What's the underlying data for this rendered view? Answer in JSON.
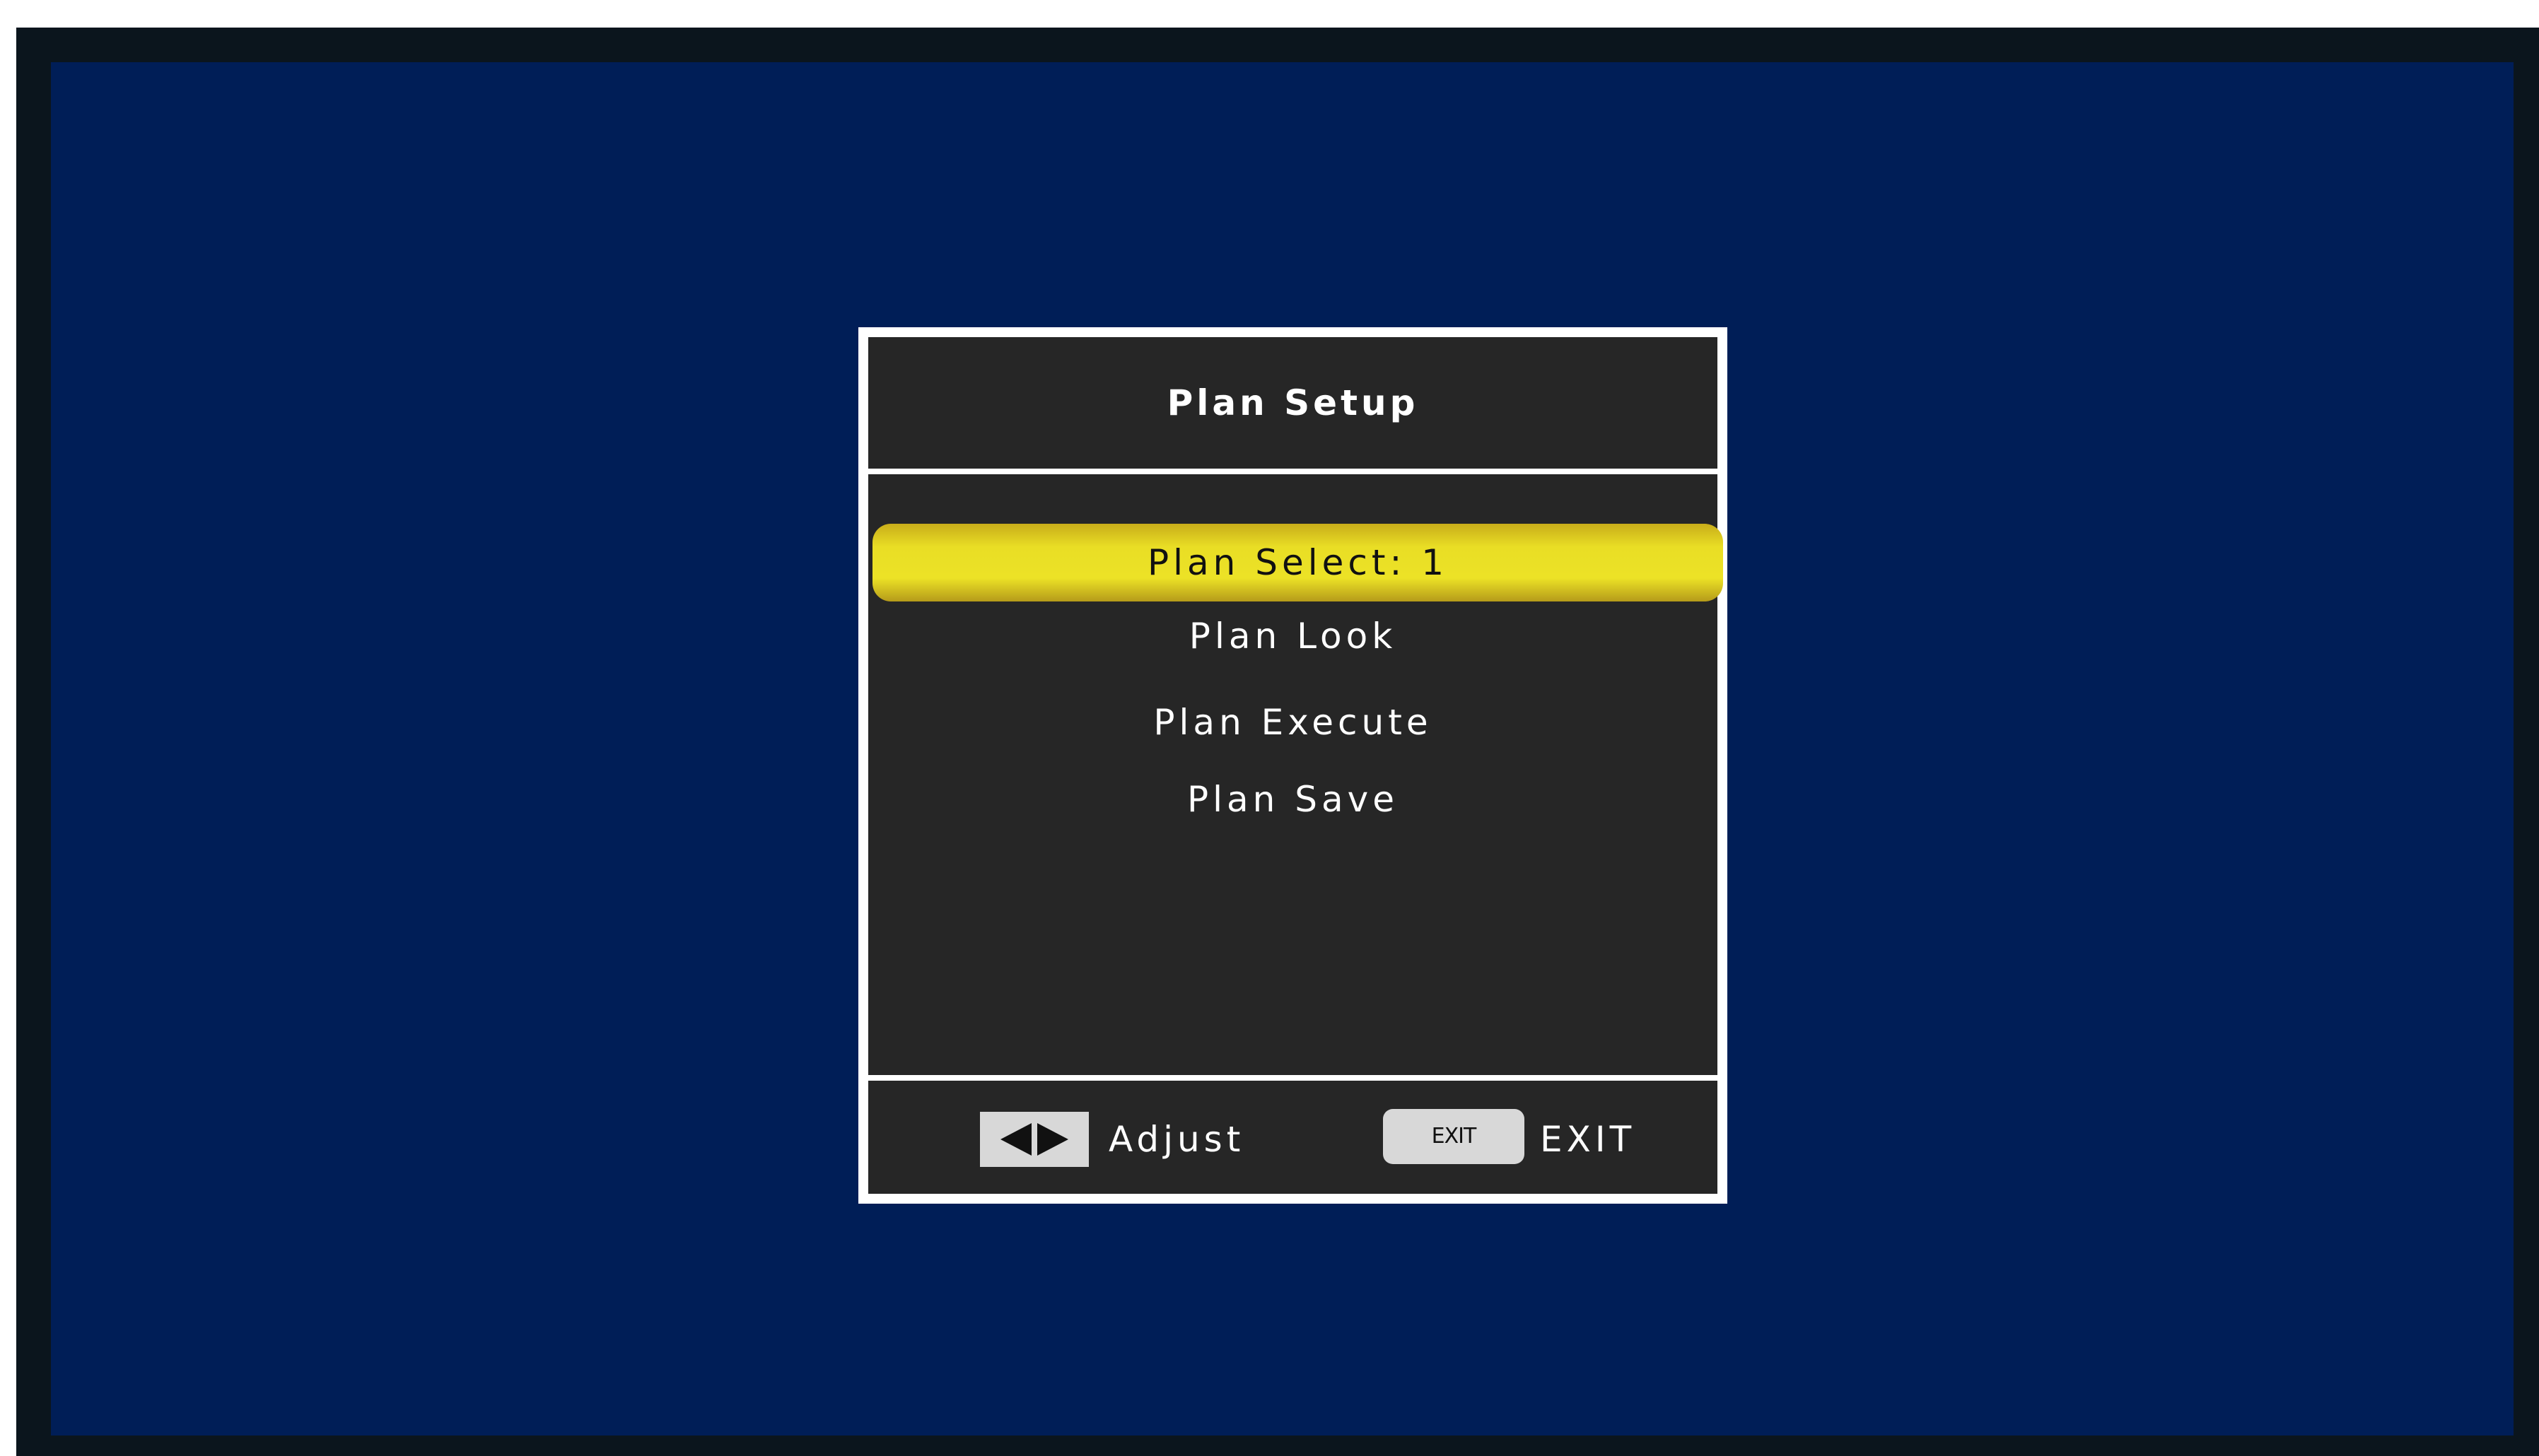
{
  "osd": {
    "title": "Plan Setup",
    "items": [
      {
        "label": "Plan Select: 1",
        "selected": true
      },
      {
        "label": "Plan Look",
        "selected": false
      },
      {
        "label": "Plan Execute",
        "selected": false
      },
      {
        "label": "Plan Save",
        "selected": false
      }
    ],
    "footer": {
      "adjust_label": "Adjust",
      "exit_key_label": "EXIT",
      "exit_label": "EXIT"
    }
  },
  "colors": {
    "screen_background": "#001e57",
    "bezel": "#0b151d",
    "panel_background": "#262626",
    "panel_border": "#ffffff",
    "highlight": "#ece226"
  }
}
